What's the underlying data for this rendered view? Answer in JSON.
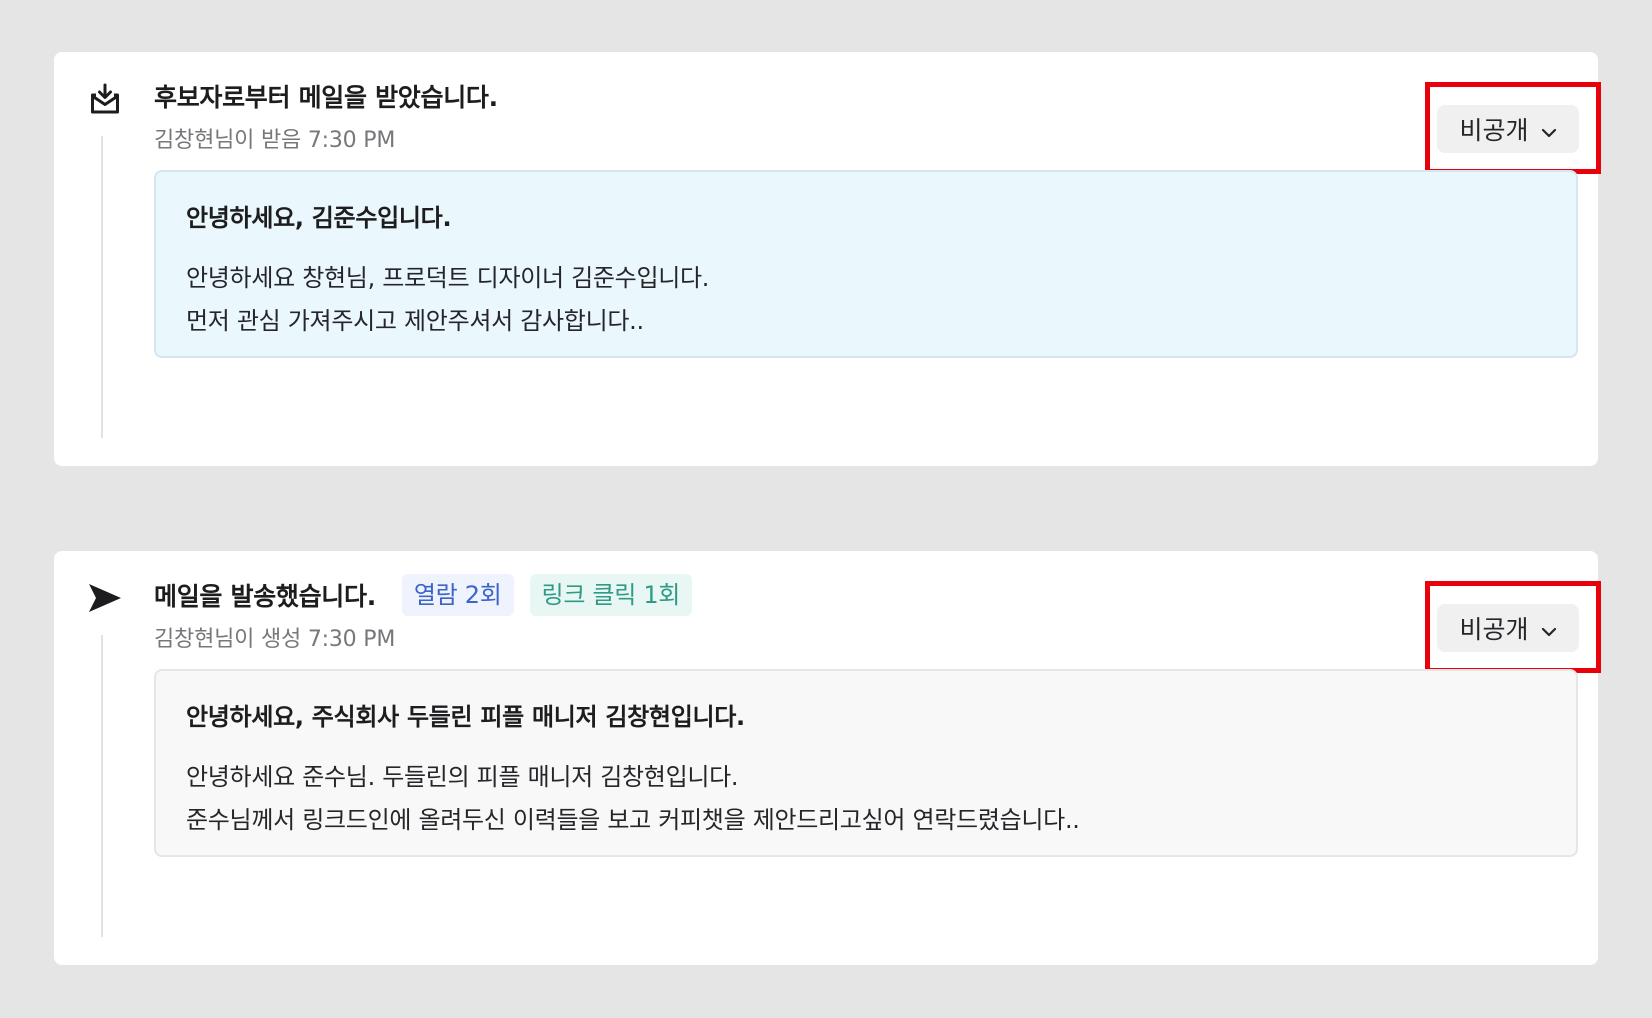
{
  "events": [
    {
      "icon": "mail-received-icon",
      "title": "후보자로부터 메일을 받았습니다.",
      "meta": "김창현님이 받음 7:30 PM",
      "visibility_label": "비공개",
      "mail": {
        "subject": "안녕하세요, 김준수입니다.",
        "lines": [
          "안녕하세요 창현님, 프로덕트 디자이너 김준수입니다.",
          "먼저 관심 가져주시고 제안주셔서 감사합니다.."
        ]
      }
    },
    {
      "icon": "send-icon",
      "title": "메일을 발송했습니다.",
      "tags": {
        "open": "열람 2회",
        "click": "링크 클릭 1회"
      },
      "meta": "김창현님이 생성 7:30 PM",
      "visibility_label": "비공개",
      "mail": {
        "subject": "안녕하세요, 주식회사 두들린 피플 매니저 김창현입니다.",
        "lines": [
          "안녕하세요 준수님. 두들린의 피플 매니저 김창현입니다.",
          "준수님께서 링크드인에 올려두신 이력들을 보고 커피챗을 제안드리고싶어 연락드렸습니다.."
        ]
      }
    }
  ],
  "colors": {
    "highlight": "#e8000b",
    "received_box": "#eaf7fd",
    "sent_box": "#f8f8f8",
    "tag_open_text": "#3d64c8",
    "tag_click_text": "#2f9a86"
  }
}
